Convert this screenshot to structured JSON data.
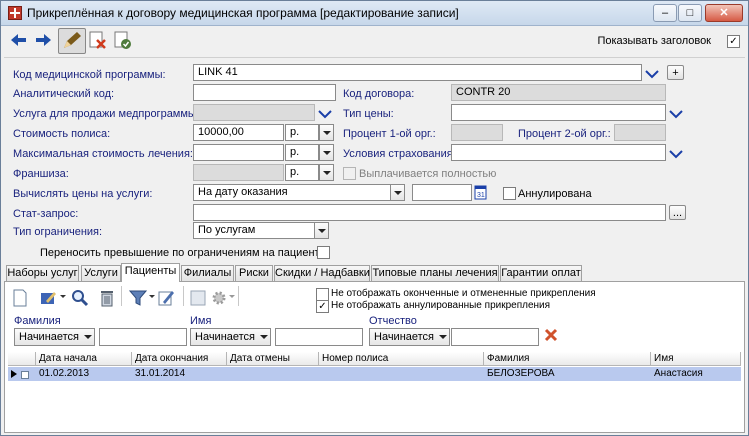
{
  "window": {
    "title": "Прикреплённая к договору медицинская программа [редактирование записи]",
    "min_glyph": "–",
    "max_glyph": "□",
    "close_glyph": "✕"
  },
  "toolbar": {
    "show_header_label": "Показывать заголовок",
    "show_header_checked": "✓"
  },
  "form": {
    "program_code_label": "Код медицинской программы:",
    "program_code_value": "LINK 41",
    "analytic_code_label": "Аналитический код:",
    "analytic_code_value": "",
    "contract_code_label": "Код договора:",
    "contract_code_value": "CONTR 20",
    "service_sale_label": "Услуга для продажи медпрограммы:",
    "service_sale_value": "",
    "price_type_label": "Тип цены:",
    "price_type_value": "",
    "policy_cost_label": "Стоимость полиса:",
    "policy_cost_value": "10000,00",
    "policy_cost_currency": "р.",
    "percent1_label": "Процент 1-ой орг.:",
    "percent1_value": "",
    "percent2_label": "Процент 2-ой орг.:",
    "percent2_value": "",
    "max_cost_label": "Максимальная стоимость лечения:",
    "max_cost_value": "",
    "max_cost_currency": "р.",
    "insurance_cond_label": "Условия страхования:",
    "insurance_cond_value": "",
    "franchise_label": "Франшиза:",
    "franchise_value": "",
    "franchise_currency": "р.",
    "paid_fully_label": "Выплачивается полностью",
    "calc_prices_label": "Вычислять цены на услуги:",
    "calc_prices_value": "На дату оказания",
    "calc_date_value": "",
    "annulled_label": "Аннулирована",
    "stat_query_label": "Стат-запрос:",
    "stat_query_value": "",
    "limit_type_label": "Тип ограничения:",
    "limit_type_value": "По услугам",
    "transfer_excess_label": "Переносить превышение по ограничениям на пациента",
    "plus_glyph": "+",
    "ellipsis_glyph": "..."
  },
  "tabs": [
    {
      "label": "Наборы услуг"
    },
    {
      "label": "Услуги"
    },
    {
      "label": "Пациенты"
    },
    {
      "label": "Филиалы"
    },
    {
      "label": "Риски"
    },
    {
      "label": "Скидки / Надбавки"
    },
    {
      "label": "Типовые планы лечения"
    },
    {
      "label": "Гарантии оплат"
    }
  ],
  "patients": {
    "hide_finished_label": "Не отображать оконченные и отмененные прикрепления",
    "hide_annulled_label": "Не отображать аннулированные прикрепления",
    "hide_annulled_checked": "✓",
    "filters": {
      "surname_label": "Фамилия",
      "name_label": "Имя",
      "patronymic_label": "Отчество",
      "mode": "Начинается"
    },
    "columns": [
      "Дата начала",
      "Дата окончания",
      "Дата отмены",
      "Номер полиса",
      "Фамилия",
      "Имя"
    ],
    "rows": [
      {
        "start": "01.02.2013",
        "end": "31.01.2014",
        "cancel": "",
        "policy": "",
        "surname": "БЕЛОЗЕРОВА",
        "name": "Анастасия"
      }
    ]
  }
}
